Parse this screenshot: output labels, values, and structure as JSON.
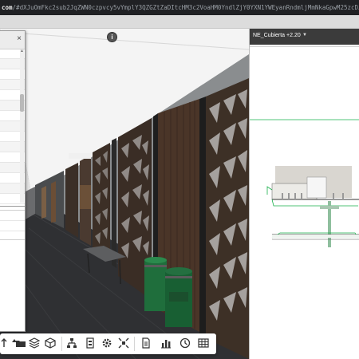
{
  "browser": {
    "url_domain": "com",
    "url_path": "/#dXJuOmFkc2sub2JqZWN0czpvcy5vYmplY3QZGZtZaDItcHM3c2VoaHM0YndlZjY0YXN1YWEyanRndmljMmNkaGpwM25zcDJ0ZWx2LWJhc2UUWFwcC9UTS1"
  },
  "viewer": {
    "info_label": "i",
    "toolbar_buttons": [
      {
        "id": "orbit",
        "icon": "orbit-icon"
      },
      {
        "id": "pan",
        "icon": "pan-icon"
      },
      {
        "id": "folder",
        "icon": "folder-icon"
      },
      {
        "id": "layers",
        "icon": "layers-icon"
      },
      {
        "id": "cube",
        "icon": "cube-icon"
      },
      {
        "id": "model-browser",
        "icon": "model-browser-icon"
      },
      {
        "id": "properties",
        "icon": "properties-icon"
      },
      {
        "id": "settings",
        "icon": "gear-icon"
      },
      {
        "id": "explode",
        "icon": "explode-icon"
      },
      {
        "id": "document",
        "icon": "document-icon"
      },
      {
        "id": "chart",
        "icon": "bar-chart-icon"
      },
      {
        "id": "timeline",
        "icon": "clock-icon"
      },
      {
        "id": "table",
        "icon": "table-icon"
      }
    ]
  },
  "sheet_panel": {
    "view_name": "NE_Cubierta +2.20",
    "dropdown_icon": "chevron-down-icon"
  },
  "colors": {
    "browser_bar": "#202124",
    "right_header": "#3b3b3b",
    "bin_green": "#1f6e3c",
    "facade_dark": "#3d3026",
    "elevation_green": "#19b04b"
  }
}
